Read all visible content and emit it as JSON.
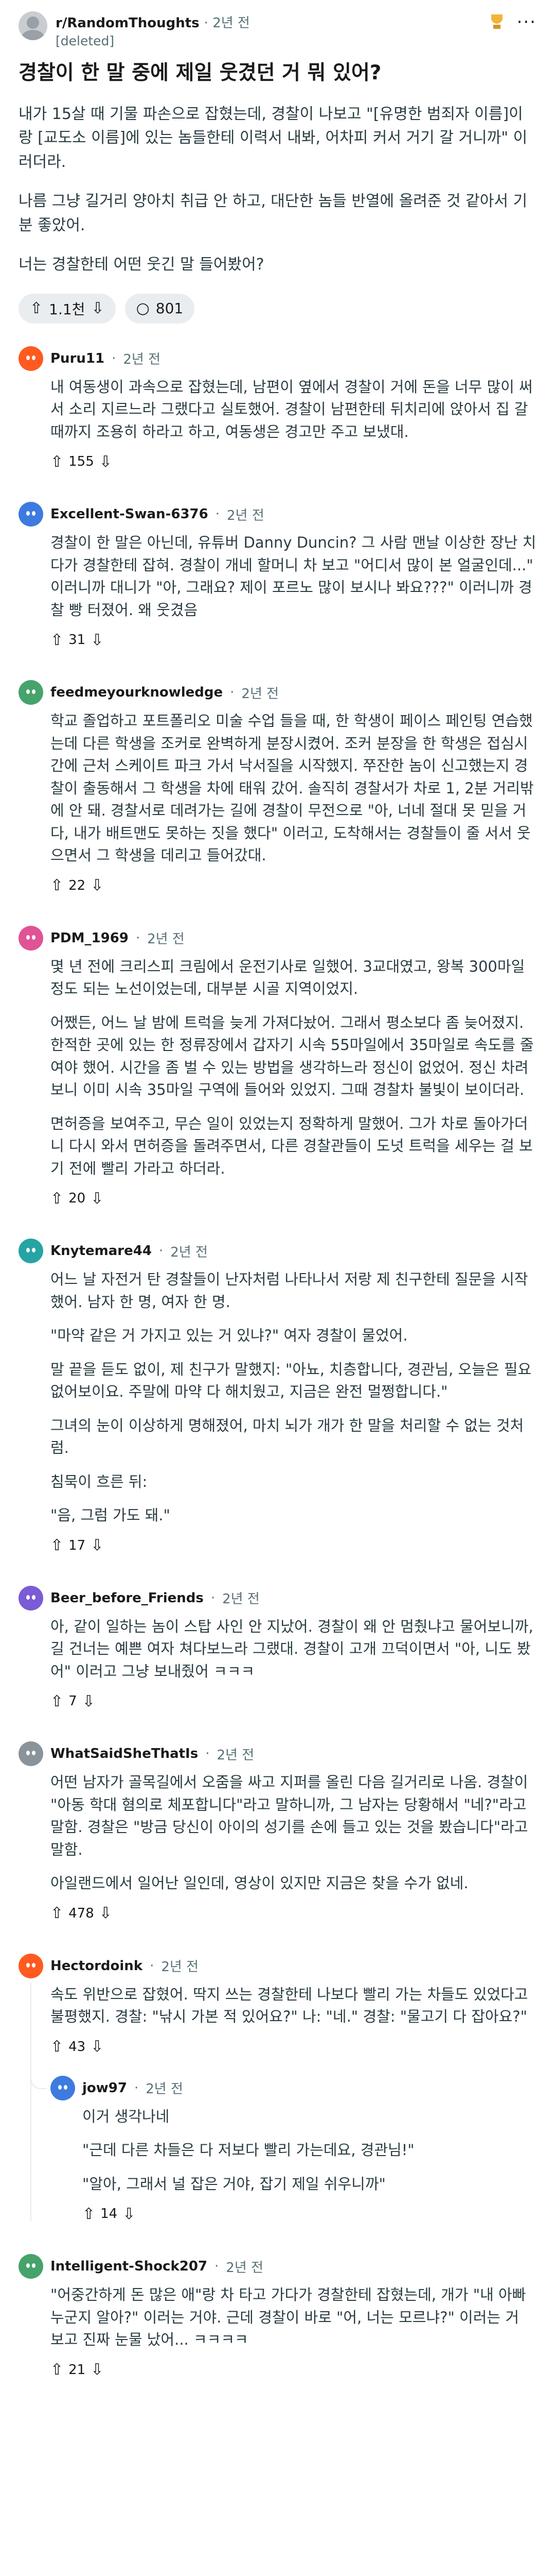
{
  "post": {
    "subreddit": "r/RandomThoughts",
    "time": "2년 전",
    "author": "[deleted]",
    "title": "경찰이 한 말 중에 제일 웃겼던 거 뭐 있어?",
    "body": [
      "내가 15살 때 기물 파손으로 잡혔는데, 경찰이 나보고 \"[유명한 범죄자 이름]이랑 [교도소 이름]에 있는 놈들한테 이력서 내봐, 어차피 커서 거기 갈 거니까\" 이러더라.",
      "나름 그냥 길거리 양아치 취급 안 하고, 대단한 놈들 반열에 올려준 것 같아서 기분 좋았어.",
      "너는 경찰한테 어떤 웃긴 말 들어봤어?"
    ],
    "votes": "1.1천",
    "comments": "801"
  },
  "comments": [
    {
      "user": "Puru11",
      "time": "2년 전",
      "avatar_color": "#ff5a1f",
      "paragraphs": [
        "내 여동생이 과속으로 잡혔는데, 남편이 옆에서 경찰이 거에 돈을 너무 많이 써서 소리 지르느라 그랬다고 실토했어. 경찰이 남편한테 뒤치리에 앉아서 집 갈 때까지 조용히 하라고 하고, 여동생은 경고만 주고 보냈대."
      ],
      "votes": "155"
    },
    {
      "user": "Excellent-Swan-6376",
      "time": "2년 전",
      "avatar_color": "#3d7be0",
      "paragraphs": [
        "경찰이 한 말은 아닌데, 유튜버 Danny Duncin? 그 사람 맨날 이상한 장난 치다가 경찰한테 잡혀. 경찰이 개네 할머니 차 보고 \"어디서 많이 본 얼굴인데...\" 이러니까 대니가 \"아, 그래요? 제이 포르노 많이 보시나 봐요???\" 이러니까 경찰 빵 터졌어. 왜 웃겼음"
      ],
      "votes": "31"
    },
    {
      "user": "feedmeyourknowledge",
      "time": "2년 전",
      "avatar_color": "#46a36b",
      "paragraphs": [
        "학교 졸업하고 포트폴리오 미술 수업 들을 때, 한 학생이 페이스 페인팅 연습했는데 다른 학생을 조커로 완벽하게 분장시켰어. 조커 분장을 한 학생은 접심시간에 근처 스케이트 파크 가서 낙서질을 시작했지. 쭈잔한 놈이 신고했는지 경찰이 출동해서 그 학생을 차에 태워 갔어. 솔직히 경찰서가 차로 1, 2분 거리밖에 안 돼. 경찰서로 데려가는 길에 경찰이 무전으로 \"아, 너네 절대 못 믿을 거다, 내가 배트맨도 못하는 짓을 했다\" 이러고, 도착해서는 경찰들이 줄 서서 웃으면서 그 학생을 데리고 들어갔대."
      ],
      "votes": "22"
    },
    {
      "user": "PDM_1969",
      "time": "2년 전",
      "avatar_color": "#e05394",
      "paragraphs": [
        "몇 년 전에 크리스피 크림에서 운전기사로 일했어. 3교대였고, 왕복 300마일 정도 되는 노선이었는데, 대부분 시골 지역이었지.",
        "어쨌든, 어느 날 밤에 트럭을 늦게 가져다놨어. 그래서 평소보다 좀 늦어졌지. 한적한 곳에 있는 한 정류장에서 갑자기 시속 55마일에서 35마일로 속도를 줄여야 했어. 시간을 좀 벌 수 있는 방법을 생각하느라 정신이 없었어. 정신 차려보니 이미 시속 35마일 구역에 들어와 있었지. 그때 경찰차 불빛이 보이더라.",
        "면허증을 보여주고, 무슨 일이 있었는지 정확하게 말했어. 그가 차로 돌아가더니 다시 와서 면허증을 돌려주면서, 다른 경찰관들이 도넛 트럭을 세우는 걸 보기 전에 빨리 가라고 하더라."
      ],
      "votes": "20"
    },
    {
      "user": "Knytemare44",
      "time": "2년 전",
      "avatar_color": "#26a4a4",
      "paragraphs": [
        "어느 날 자전거 탄 경찰들이 난자처럼 나타나서 저랑 제 친구한테 질문을 시작했어. 남자 한 명, 여자 한 명.",
        "\"마약 같은 거 가지고 있는 거 있냐?\" 여자 경찰이 물었어.",
        "말 끝을 듣도 없이, 제 친구가 말했지: \"아뇨, 치층합니다, 경관님, 오늘은 필요없어보이요. 주말에 마약 다 해치웠고, 지금은 완전 멀쩡합니다.\"",
        "그녀의 눈이 이상하게 명해졌어, 마치 뇌가 개가 한 말을 처리할 수 없는 것처럼.",
        "침묵이 흐른 뒤:",
        "\"음, 그럼 가도 돼.\""
      ],
      "votes": "17"
    },
    {
      "user": "Beer_before_Friends",
      "time": "2년 전",
      "avatar_color": "#7b5bd6",
      "paragraphs": [
        "아, 같이 일하는 놈이 스탑 사인 안 지났어. 경찰이 왜 안 멈췄냐고 물어보니까, 길 건너는 예쁜 여자 쳐다보느라 그랬대. 경찰이 고개 끄덕이면서 \"아, 니도 봤어\" 이러고 그냥 보내줬어 ㅋㅋㅋ"
      ],
      "votes": "7"
    },
    {
      "user": "WhatSaidSheThatIs",
      "time": "2년 전",
      "avatar_color": "#8a939a",
      "paragraphs": [
        "어떤 남자가 골목길에서 오줌을 싸고 지퍼를 올린 다음 길거리로 나옴. 경찰이 \"아동 학대 혐의로 체포합니다\"라고 말하니까, 그 남자는 당황해서 \"네?\"라고 말함. 경찰은 \"방금 당신이 아이의 성기를 손에 들고 있는 것을 봤습니다\"라고 말함.",
        "아일랜드에서 일어난 일인데, 영상이 있지만 지금은 찾을 수가 없네."
      ],
      "votes": "478"
    },
    {
      "user": "Hectordoink",
      "time": "2년 전",
      "avatar_color": "#ff5a1f",
      "paragraphs": [
        "속도 위반으로 잡혔어. 딱지 쓰는 경찰한테 나보다 빨리 가는 차들도 있었다고 불평했지. 경찰: \"낚시 가본 적 있어요?\" 나: \"네.\" 경찰: \"물고기 다 잡아요?\""
      ],
      "votes": "43",
      "reply": {
        "user": "jow97",
        "time": "2년 전",
        "avatar_color": "#3d7be0",
        "paragraphs": [
          "이거 생각나네",
          "\"근데 다른 차들은 다 저보다 빨리 가는데요, 경관님!\"",
          "\"알아, 그래서 널 잡은 거야, 잡기 제일 쉬우니까\""
        ],
        "votes": "14"
      }
    },
    {
      "user": "Intelligent-Shock207",
      "time": "2년 전",
      "avatar_color": "#46a36b",
      "paragraphs": [
        "\"어중간하게 돈 많은 애\"랑 차 타고 가다가 경찰한테 잡혔는데, 개가 \"내 아빠 누군지 알아?\" 이러는 거야. 근데 경찰이 바로 \"어, 너는 모르냐?\" 이러는 거 보고 진짜 눈물 났어... ㅋㅋㅋㅋ"
      ],
      "votes": "21"
    }
  ]
}
